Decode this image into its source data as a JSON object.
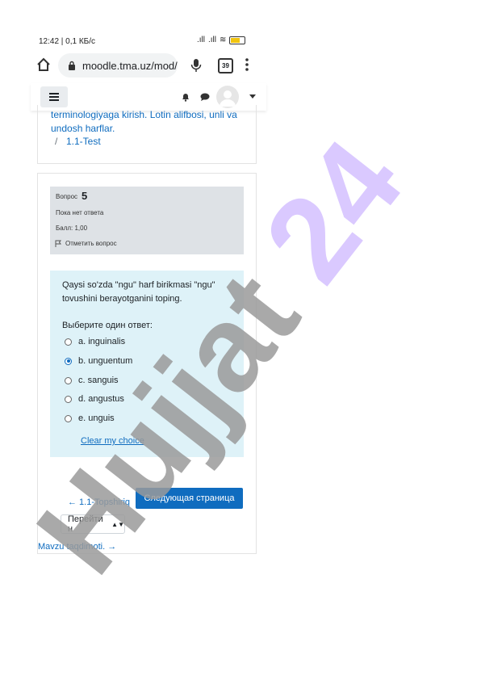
{
  "status_bar": {
    "time": "12:42 | 0,1 КБ/с",
    "battery": "65"
  },
  "browser": {
    "url": "moodle.tma.uz/mod/",
    "tab_count": "39"
  },
  "breadcrumb": {
    "text": "terminologiyaga kirish. Lotin alifbosi, unli va undosh harflar.",
    "separator": "/",
    "current": "1.1-Test"
  },
  "question_info": {
    "label": "Вопрос",
    "number": "5",
    "state": "Пока нет ответа",
    "grade": "Балл: 1,00",
    "flag_label": "Отметить вопрос"
  },
  "question": {
    "text": "Qaysi so'zda \"ngu\" harf birikmasi \"ngu\" tovushini berayotganini toping.",
    "prompt": "Выберите один ответ:",
    "options": [
      {
        "label": "a. inguinalis",
        "checked": false
      },
      {
        "label": "b. unguentum",
        "checked": true
      },
      {
        "label": "c. sanguis",
        "checked": false
      },
      {
        "label": "d. angustus",
        "checked": false
      },
      {
        "label": "e. unguis",
        "checked": false
      }
    ],
    "clear_label": "Clear my choice"
  },
  "navigation": {
    "prev_label": "← 1.1-Topshiriq",
    "next_label": "Следующая страница",
    "jump_label": "Перейти н",
    "next_activity_label": "Mavzu taqdimoti. →"
  },
  "watermark": {
    "text": "Hujjat 24"
  },
  "colors": {
    "link": "#0f6cbf",
    "info_bg": "#dee2e6",
    "content_bg": "#def2f8",
    "primary": "#0f6cbf"
  },
  "icons": [
    "home-icon",
    "lock-icon",
    "mic-icon",
    "tabs-icon",
    "menu-dots-icon",
    "hamburger-icon",
    "bell-icon",
    "chat-icon",
    "avatar",
    "chevron-down-icon",
    "flag-icon"
  ]
}
